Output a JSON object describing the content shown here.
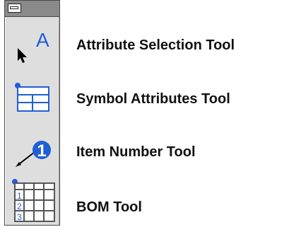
{
  "tools": [
    {
      "name": "attribute-selection",
      "label": "Attribute Selection Tool",
      "icon": "attribute-selection-icon",
      "glyph": "A"
    },
    {
      "name": "symbol-attributes",
      "label": "Symbol Attributes Tool",
      "icon": "symbol-attributes-icon"
    },
    {
      "name": "item-number",
      "label": "Item Number Tool",
      "icon": "item-number-icon",
      "glyph": "1"
    },
    {
      "name": "bom",
      "label": "BOM Tool",
      "icon": "bom-icon",
      "glyph_rows": [
        "1",
        "2",
        "3"
      ]
    }
  ],
  "colors": {
    "accent": "#1f5fd6",
    "palette_bg": "#dedede",
    "titlebar": "#8a8a8a"
  }
}
